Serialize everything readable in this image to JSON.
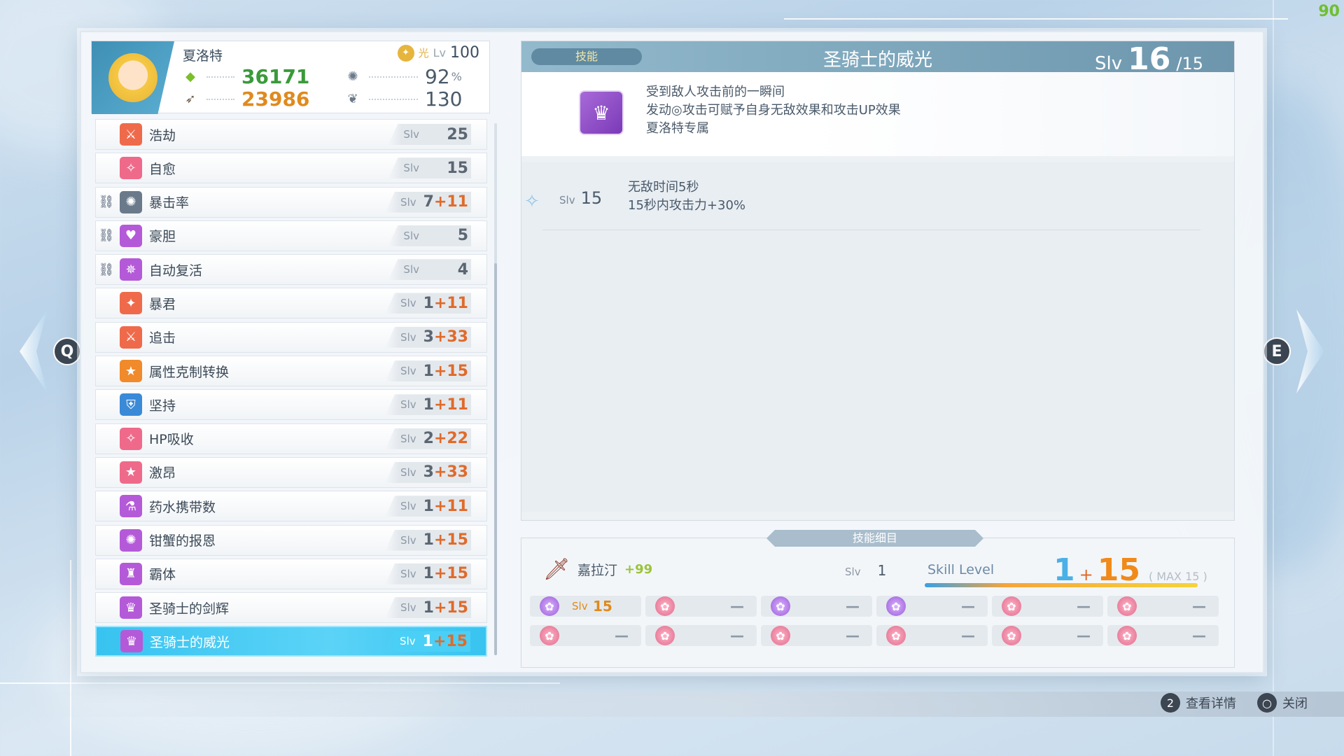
{
  "fps": "90",
  "character": {
    "name": "夏洛特",
    "element_icon": "light-element-icon",
    "element_label": "光",
    "level_label": "Lv",
    "level": "100",
    "hp": "36171",
    "atk": "23986",
    "crit_rate": "92",
    "crit_unit": "%",
    "stat4": "130"
  },
  "skills": [
    {
      "name": "浩劫",
      "slv_label": "Slv",
      "base": "25",
      "bonus": "",
      "icon": "sword-icon",
      "color": "#ef6a4a",
      "locked": false
    },
    {
      "name": "自愈",
      "slv_label": "Slv",
      "base": "15",
      "bonus": "",
      "icon": "sparkle-icon",
      "color": "#ef6a8a",
      "locked": false
    },
    {
      "name": "暴击率",
      "slv_label": "Slv",
      "base": "7",
      "bonus": "+11",
      "icon": "gear-icon",
      "color": "#6a7a8a",
      "locked": true
    },
    {
      "name": "豪胆",
      "slv_label": "Slv",
      "base": "5",
      "bonus": "",
      "icon": "heart-icon",
      "color": "#b45ad8",
      "locked": true
    },
    {
      "name": "自动复活",
      "slv_label": "Slv",
      "base": "4",
      "bonus": "",
      "icon": "angel-icon",
      "color": "#b45ad8",
      "locked": true
    },
    {
      "name": "暴君",
      "slv_label": "Slv",
      "base": "1",
      "bonus": "+11",
      "icon": "tyrant-icon",
      "color": "#ef6a4a",
      "locked": false
    },
    {
      "name": "追击",
      "slv_label": "Slv",
      "base": "3",
      "bonus": "+33",
      "icon": "sword-icon",
      "color": "#ef6a4a",
      "locked": false
    },
    {
      "name": "属性克制转换",
      "slv_label": "Slv",
      "base": "1",
      "bonus": "+15",
      "icon": "star-icon",
      "color": "#f08a2a",
      "locked": false
    },
    {
      "name": "坚持",
      "slv_label": "Slv",
      "base": "1",
      "bonus": "+11",
      "icon": "shield-icon",
      "color": "#3a8ad8",
      "locked": false
    },
    {
      "name": "HP吸收",
      "slv_label": "Slv",
      "base": "2",
      "bonus": "+22",
      "icon": "sparkle-icon",
      "color": "#ef6a8a",
      "locked": false
    },
    {
      "name": "激昂",
      "slv_label": "Slv",
      "base": "3",
      "bonus": "+33",
      "icon": "star-icon",
      "color": "#ef6a8a",
      "locked": false
    },
    {
      "name": "药水携带数",
      "slv_label": "Slv",
      "base": "1",
      "bonus": "+11",
      "icon": "potion-icon",
      "color": "#b45ad8",
      "locked": false
    },
    {
      "name": "钳蟹的报恩",
      "slv_label": "Slv",
      "base": "1",
      "bonus": "+15",
      "icon": "crab-icon",
      "color": "#b45ad8",
      "locked": false
    },
    {
      "name": "霸体",
      "slv_label": "Slv",
      "base": "1",
      "bonus": "+15",
      "icon": "armor-icon",
      "color": "#b45ad8",
      "locked": false
    },
    {
      "name": "圣骑士的剑辉",
      "slv_label": "Slv",
      "base": "1",
      "bonus": "+15",
      "icon": "knight-icon",
      "color": "#b45ad8",
      "locked": false
    },
    {
      "name": "圣骑士的威光",
      "slv_label": "Slv",
      "base": "1",
      "bonus": "+15",
      "icon": "knight-icon",
      "color": "#b45ad8",
      "locked": false,
      "selected": true
    }
  ],
  "detail": {
    "tag": "技能",
    "title": "圣骑士的威光",
    "slv_label": "Slv",
    "slv_current": "16",
    "slv_max": "/15",
    "desc_line1": "受到敌人攻击前的一瞬间",
    "desc_line2": "发动◎攻击可赋予自身无敌效果和攻击UP效果",
    "desc_line3": "夏洛特专属",
    "effect_slv_label": "Slv",
    "effect_slv": "15",
    "effect_line1": "无敌时间5秒",
    "effect_line2": "15秒内攻击力+30%"
  },
  "breakdown": {
    "tab": "技能细目",
    "weapon_name": "嘉拉汀",
    "weapon_plus": "+99",
    "weapon_slv_label": "Slv",
    "weapon_slv": "1",
    "skill_level_label": "Skill Level",
    "skill_level_base": "1",
    "skill_level_plus": "+",
    "skill_level_bonus": "15",
    "skill_level_max": "( MAX 15 )",
    "skill_level_fill_fraction": 1.0,
    "slots_row1": [
      {
        "gem": "purple",
        "label": "Slv",
        "value": "15"
      },
      {
        "gem": "pink",
        "value": "—"
      },
      {
        "gem": "purple",
        "value": "—"
      },
      {
        "gem": "purple",
        "value": "—"
      },
      {
        "gem": "pink",
        "value": "—"
      },
      {
        "gem": "pink",
        "value": "—"
      }
    ],
    "slots_row2": [
      {
        "gem": "pink",
        "value": "—"
      },
      {
        "gem": "pink",
        "value": "—"
      },
      {
        "gem": "pink",
        "value": "—"
      },
      {
        "gem": "pink",
        "value": "—"
      },
      {
        "gem": "pink",
        "value": "—"
      },
      {
        "gem": "pink",
        "value": "—"
      }
    ]
  },
  "nav": {
    "prev_key": "Q",
    "next_key": "E"
  },
  "footer": {
    "detail_key": "2",
    "detail_label": "查看详情",
    "close_key": "○",
    "close_label": "关闭"
  }
}
